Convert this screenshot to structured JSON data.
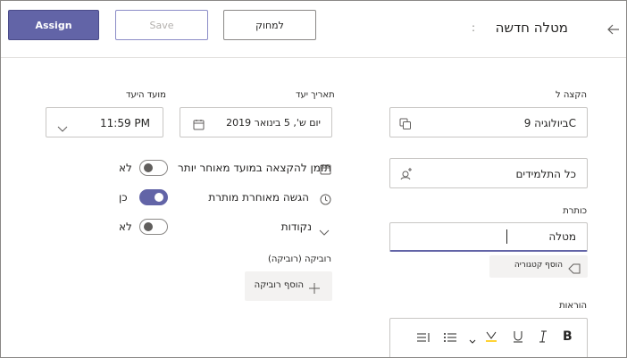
{
  "header": {
    "title": "מטלה חדשה",
    "assign_label": "Assign",
    "save_label": "Save",
    "discard_label": "למחוק"
  },
  "assign_to": {
    "label": "הקצה ל",
    "class_value": "ביולוגיה 9C",
    "students_value": "כל התלמידים"
  },
  "due": {
    "date_label": "תאריך יעד",
    "date_value": "יום ש', 5 בינואר 2019",
    "time_label": "מועד היעד",
    "time_value": "11:59 PM"
  },
  "toggles": [
    {
      "label": "תזמן להקצאה במועד מאוחר יותר",
      "state_text": "לא",
      "on": false
    },
    {
      "label": "הגשה מאוחרת מותרת",
      "state_text": "כן",
      "on": true
    },
    {
      "label": "נקודות",
      "state_text": "לא",
      "on": false
    }
  ],
  "rubric": {
    "label": "רוביקה (רוביקה)",
    "add_label": "הוסף רוביקה"
  },
  "title_field": {
    "label": "כותרת",
    "value": "מטלה",
    "add_category_label": "הוסף קטגוריה"
  },
  "instructions": {
    "label": "הוראות"
  },
  "colors": {
    "accent": "#6264a7",
    "border": "#c8c6c4"
  }
}
